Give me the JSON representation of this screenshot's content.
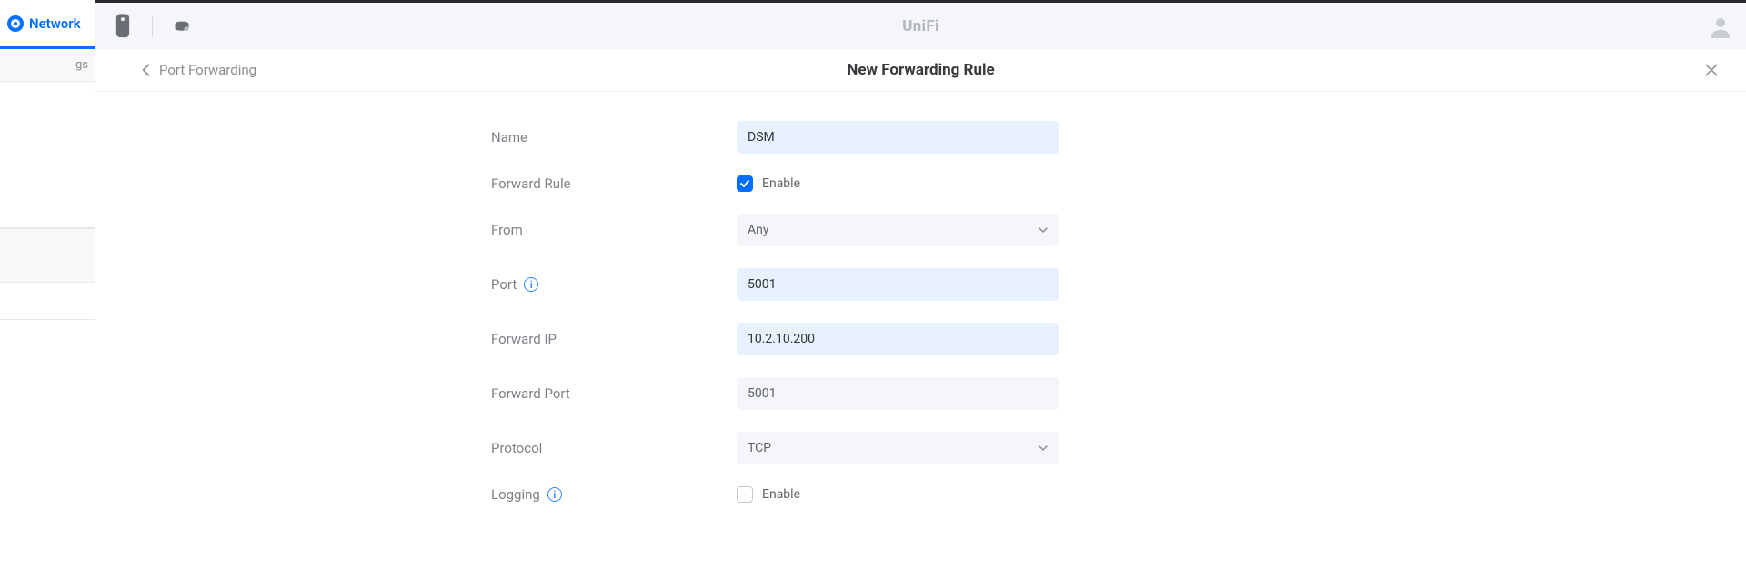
{
  "sidebar": {
    "network_label": "Network",
    "truncated_item": "gs"
  },
  "topbar": {
    "brand": "UniFi"
  },
  "header": {
    "back_label": "Port Forwarding",
    "title": "New Forwarding Rule"
  },
  "form": {
    "name": {
      "label": "Name",
      "value": "DSM"
    },
    "forward_rule": {
      "label": "Forward Rule",
      "checkbox_label": "Enable",
      "checked": true
    },
    "from": {
      "label": "From",
      "value": "Any"
    },
    "port": {
      "label": "Port",
      "value": "5001"
    },
    "forward_ip": {
      "label": "Forward IP",
      "value": "10.2.10.200"
    },
    "forward_port": {
      "label": "Forward Port",
      "value": "5001"
    },
    "protocol": {
      "label": "Protocol",
      "value": "TCP"
    },
    "logging": {
      "label": "Logging",
      "checkbox_label": "Enable",
      "checked": false
    }
  }
}
